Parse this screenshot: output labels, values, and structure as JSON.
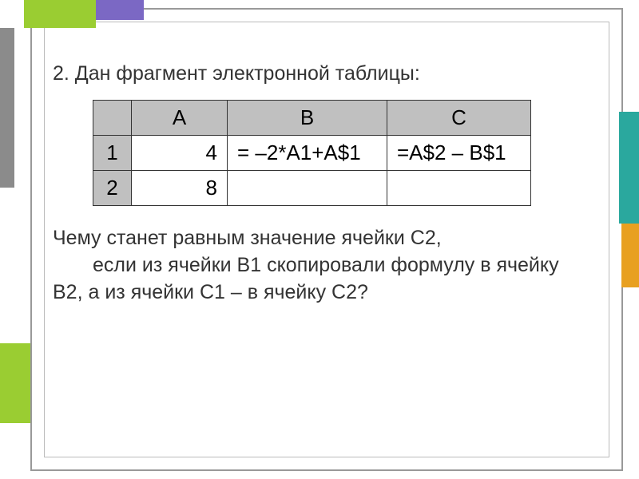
{
  "slide": {
    "intro": "2. Дан фрагмент электронной таблицы:",
    "question_l1": "Чему станет равным значение ячейки С2,",
    "question_l2": "если из ячейки В1 скопировали формулу в ячейку В2, а из ячейки С1 – в ячейку С2?"
  },
  "table": {
    "headers": {
      "corner": "",
      "A": "А",
      "B": "В",
      "C": "С"
    },
    "rows": [
      {
        "header": "1",
        "A": "4",
        "B": "= –2*A1+A$1",
        "C": "=A$2 – B$1"
      },
      {
        "header": "2",
        "A": "8",
        "B": "",
        "C": ""
      }
    ]
  }
}
